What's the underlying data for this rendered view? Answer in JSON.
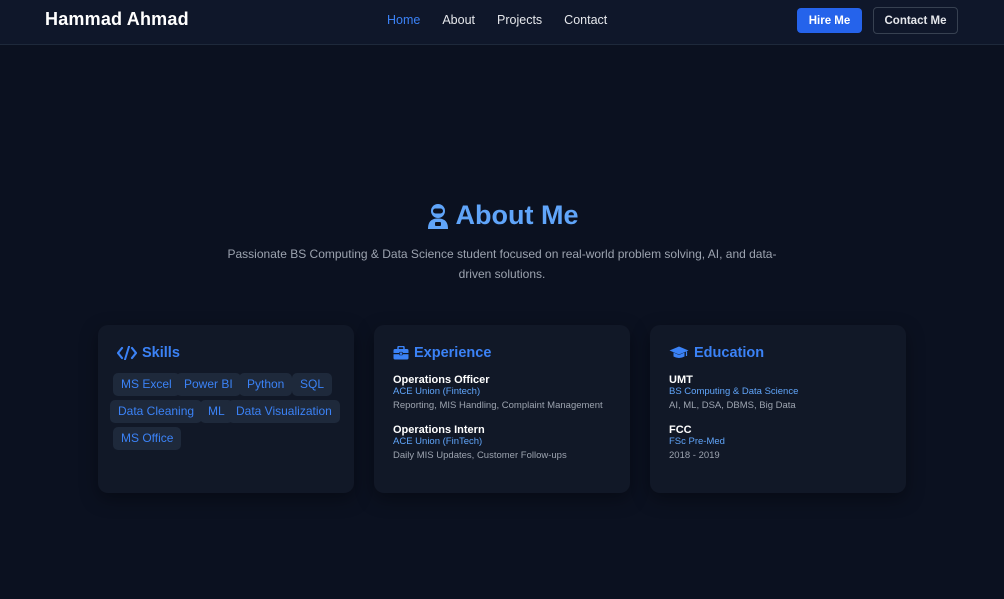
{
  "nav": {
    "brand": "Hammad Ahmad",
    "links": [
      "Home",
      "About",
      "Projects",
      "Contact"
    ],
    "hire_label": "Hire Me",
    "contact_label": "Contact Me"
  },
  "about": {
    "title": "About Me",
    "intro": "Passionate BS Computing & Data Science student focused on real-world problem solving, AI, and data-driven solutions."
  },
  "skills": {
    "title": "Skills",
    "tags": [
      "MS Excel",
      "Power BI",
      "Python",
      "SQL",
      "Data Cleaning",
      "ML",
      "Data Visualization",
      "MS Office"
    ]
  },
  "experience": {
    "title": "Experience",
    "items": [
      {
        "role": "Operations Officer",
        "org": "ACE Union (Fintech)",
        "desc": "Reporting, MIS Handling, Complaint Management"
      },
      {
        "role": "Operations Intern",
        "org": "ACE Union (FinTech)",
        "desc": "Daily MIS Updates, Customer Follow-ups"
      }
    ]
  },
  "education": {
    "title": "Education",
    "items": [
      {
        "school": "UMT",
        "degree": "BS Computing & Data Science",
        "desc": "AI, ML, DSA, DBMS, Big Data"
      },
      {
        "school": "FCC",
        "degree": "FSc Pre-Med",
        "desc": "2018 - 2019"
      }
    ]
  },
  "colors": {
    "background": "#0b1120",
    "navbar": "#0f172a",
    "card": "#111827",
    "accent": "#3b82f6",
    "accent_light": "#60a5fa",
    "tag_bg": "#1e293b",
    "muted_text": "#9ca3af"
  },
  "icons": {
    "about": "user-astronaut-icon",
    "skills": "code-icon",
    "experience": "briefcase-icon",
    "education": "graduation-cap-icon"
  }
}
